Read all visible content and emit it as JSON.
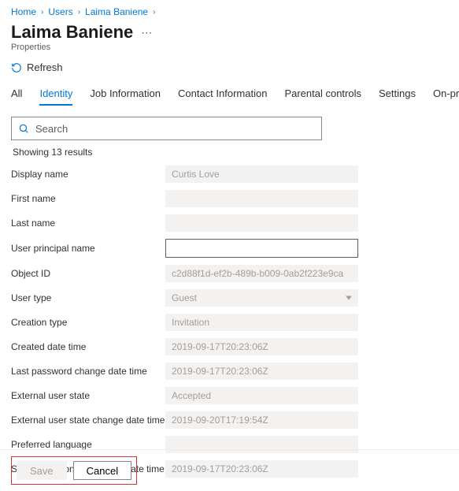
{
  "breadcrumb": {
    "items": [
      "Home",
      "Users",
      "Laima Baniene"
    ]
  },
  "header": {
    "title": "Laima Baniene",
    "subtitle": "Properties",
    "refresh_label": "Refresh"
  },
  "tabs": {
    "items": [
      {
        "label": "All"
      },
      {
        "label": "Identity"
      },
      {
        "label": "Job Information"
      },
      {
        "label": "Contact Information"
      },
      {
        "label": "Parental controls"
      },
      {
        "label": "Settings"
      },
      {
        "label": "On-premises"
      }
    ],
    "active_index": 1
  },
  "search": {
    "placeholder": "Search"
  },
  "results_text": "Showing 13 results",
  "fields": [
    {
      "label": "Display name",
      "value": "Curtis Love"
    },
    {
      "label": "First name",
      "value": ""
    },
    {
      "label": "Last name",
      "value": ""
    },
    {
      "label": "User principal name",
      "value": "",
      "editable": true
    },
    {
      "label": "Object ID",
      "value": "c2d88f1d-ef2b-489b-b009-0ab2f223e9ca"
    },
    {
      "label": "User type",
      "value": "Guest",
      "dropdown": true
    },
    {
      "label": "Creation type",
      "value": "Invitation"
    },
    {
      "label": "Created date time",
      "value": "2019-09-17T20:23:06Z"
    },
    {
      "label": "Last password change date time",
      "value": "2019-09-17T20:23:06Z"
    },
    {
      "label": "External user state",
      "value": "Accepted"
    },
    {
      "label": "External user state change date time",
      "value": "2019-09-20T17:19:54Z"
    },
    {
      "label": "Preferred language",
      "value": ""
    },
    {
      "label": "Sign in sessions valid from date time",
      "value": "2019-09-17T20:23:06Z"
    }
  ],
  "footer": {
    "save_label": "Save",
    "cancel_label": "Cancel"
  }
}
